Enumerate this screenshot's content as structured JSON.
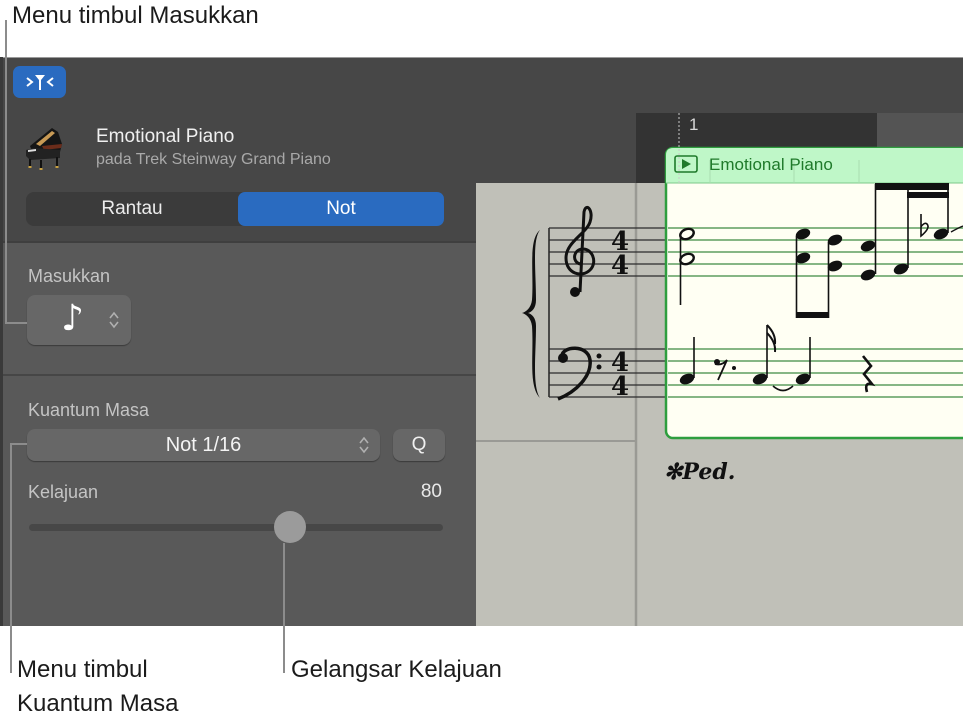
{
  "callouts": {
    "insert_menu": "Menu timbul Masukkan",
    "quantize_menu_line1": "Menu timbul",
    "quantize_menu_line2": "Kuantum Masa",
    "velocity_slider": "Gelangsar Kelajuan"
  },
  "toolbar": {
    "catch_button_icon": "catch-playhead-icon"
  },
  "track": {
    "icon": "grand-piano-icon",
    "title": "Emotional Piano",
    "subtitle": "pada Trek Steinway Grand Piano"
  },
  "view_toggle": {
    "items": [
      "Rantau",
      "Not"
    ],
    "selected": "Not"
  },
  "insert": {
    "label": "Masukkan",
    "value_icon": "eighth-note-icon",
    "value_glyph": "♪"
  },
  "quantize": {
    "label": "Kuantum Masa",
    "value": "Not 1/16",
    "q_button": "Q"
  },
  "velocity": {
    "label": "Kelajuan",
    "value": "80",
    "max": 127
  },
  "score": {
    "ruler_bar": "1",
    "region_name": "Emotional Piano",
    "time_signature": [
      "4",
      "4"
    ],
    "pedal_marking": "✻Ped.",
    "colors": {
      "region_header": "#bff7c8",
      "region_border": "#2e9e3e",
      "region_body": "#fffff3",
      "staff_in_region": "#5f9e5f",
      "accent_blue": "#2a6bc0"
    }
  }
}
